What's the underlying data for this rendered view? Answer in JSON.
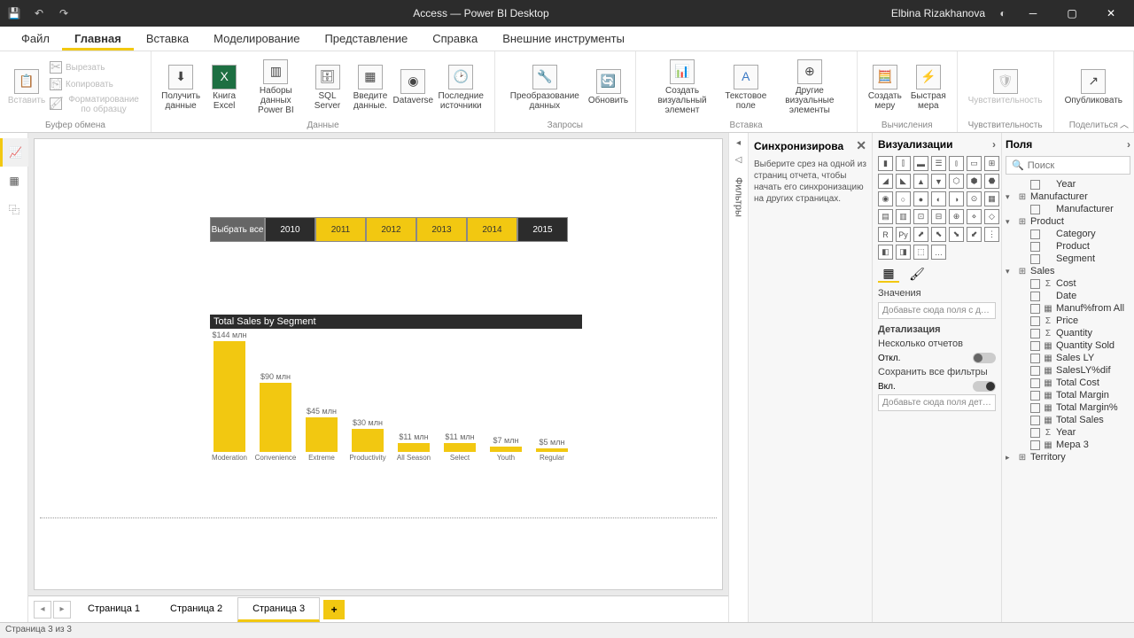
{
  "titlebar": {
    "title": "Access — Power BI Desktop",
    "user": "Elbina Rizakhanova"
  },
  "menu": {
    "items": [
      "Файл",
      "Главная",
      "Вставка",
      "Моделирование",
      "Представление",
      "Справка",
      "Внешние инструменты"
    ],
    "active": 1
  },
  "ribbon": {
    "clipboard": {
      "paste": "Вставить",
      "cut": "Вырезать",
      "copy": "Копировать",
      "format": "Форматирование по образцу",
      "label": "Буфер обмена"
    },
    "data": {
      "get": "Получить данные",
      "excel": "Книга Excel",
      "pbi": "Наборы данных Power BI",
      "sql": "SQL Server",
      "enter": "Введите данные.",
      "dataverse": "Dataverse",
      "recent": "Последние источники",
      "label": "Данные"
    },
    "queries": {
      "transform": "Преобразование данных",
      "refresh": "Обновить",
      "label": "Запросы"
    },
    "insert": {
      "visual": "Создать визуальный элемент",
      "text": "Текстовое поле",
      "more": "Другие визуальные элементы",
      "label": "Вставка"
    },
    "calc": {
      "measure": "Создать меру",
      "quick": "Быстрая мера",
      "label": "Вычисления"
    },
    "sens": {
      "btn": "Чувствительность",
      "label": "Чувствительность"
    },
    "share": {
      "publish": "Опубликовать",
      "label": "Поделиться"
    }
  },
  "slicer": {
    "all": "Выбрать все",
    "items": [
      {
        "label": "2010",
        "cls": "dark"
      },
      {
        "label": "2011",
        "cls": "yellow"
      },
      {
        "label": "2012",
        "cls": "yellow"
      },
      {
        "label": "2013",
        "cls": "yellow"
      },
      {
        "label": "2014",
        "cls": "yellow"
      },
      {
        "label": "2015",
        "cls": "dark"
      }
    ]
  },
  "chart_data": {
    "type": "bar",
    "title": "Total Sales by Segment",
    "categories": [
      "Moderation",
      "Convenience",
      "Extreme",
      "Productivity",
      "All Season",
      "Select",
      "Youth",
      "Regular"
    ],
    "value_labels": [
      "$144 млн",
      "$90 млн",
      "$45 млн",
      "$30 млн",
      "$11 млн",
      "$11 млн",
      "$7 млн",
      "$5 млн"
    ],
    "values": [
      144,
      90,
      45,
      30,
      11,
      11,
      7,
      5
    ],
    "ylim": [
      0,
      150
    ]
  },
  "pages": {
    "tabs": [
      "Страница 1",
      "Страница 2",
      "Страница 3"
    ],
    "active": 2
  },
  "filters_label": "Фильтры",
  "sync": {
    "title": "Синхронизирова",
    "text": "Выберите срез на одной из страниц отчета, чтобы начать его синхронизацию на других страницах."
  },
  "viz": {
    "title": "Визуализации",
    "values_label": "Значения",
    "values_placeholder": "Добавьте сюда поля с дан…",
    "drill_label": "Детализация",
    "cross_report": "Несколько отчетов",
    "off": "Откл.",
    "keep_filters": "Сохранить все фильтры",
    "on": "Вкл.",
    "drill_placeholder": "Добавьте сюда поля дета…"
  },
  "fields": {
    "title": "Поля",
    "search": "Поиск",
    "tree": [
      {
        "lvl": 2,
        "chk": true,
        "icon": "",
        "label": "Year"
      },
      {
        "lvl": 0,
        "chev": "▾",
        "icon": "⊞",
        "label": "Manufacturer"
      },
      {
        "lvl": 2,
        "chk": true,
        "icon": "",
        "label": "Manufacturer"
      },
      {
        "lvl": 0,
        "chev": "▾",
        "icon": "⊞",
        "label": "Product"
      },
      {
        "lvl": 2,
        "chk": true,
        "icon": "",
        "label": "Category"
      },
      {
        "lvl": 2,
        "chk": true,
        "icon": "",
        "label": "Product"
      },
      {
        "lvl": 2,
        "chk": true,
        "icon": "",
        "label": "Segment"
      },
      {
        "lvl": 0,
        "chev": "▾",
        "icon": "⊞",
        "label": "Sales"
      },
      {
        "lvl": 2,
        "chk": true,
        "icon": "Σ",
        "label": "Cost"
      },
      {
        "lvl": 2,
        "chk": true,
        "icon": "",
        "label": "Date"
      },
      {
        "lvl": 2,
        "chk": true,
        "icon": "▦",
        "label": "Manuf%from All"
      },
      {
        "lvl": 2,
        "chk": true,
        "icon": "Σ",
        "label": "Price"
      },
      {
        "lvl": 2,
        "chk": true,
        "icon": "Σ",
        "label": "Quantity"
      },
      {
        "lvl": 2,
        "chk": true,
        "icon": "▦",
        "label": "Quantity Sold"
      },
      {
        "lvl": 2,
        "chk": true,
        "icon": "▦",
        "label": "Sales LY"
      },
      {
        "lvl": 2,
        "chk": true,
        "icon": "▦",
        "label": "SalesLY%dif"
      },
      {
        "lvl": 2,
        "chk": true,
        "icon": "▦",
        "label": "Total Cost"
      },
      {
        "lvl": 2,
        "chk": true,
        "icon": "▦",
        "label": "Total Margin"
      },
      {
        "lvl": 2,
        "chk": true,
        "icon": "▦",
        "label": "Total Margin%"
      },
      {
        "lvl": 2,
        "chk": true,
        "icon": "▦",
        "label": "Total Sales"
      },
      {
        "lvl": 2,
        "chk": true,
        "icon": "Σ",
        "label": "Year"
      },
      {
        "lvl": 2,
        "chk": true,
        "icon": "▦",
        "label": "Мера 3"
      },
      {
        "lvl": 0,
        "chev": "▸",
        "icon": "⊞",
        "label": "Territory"
      }
    ]
  },
  "status": "Страница 3 из 3"
}
